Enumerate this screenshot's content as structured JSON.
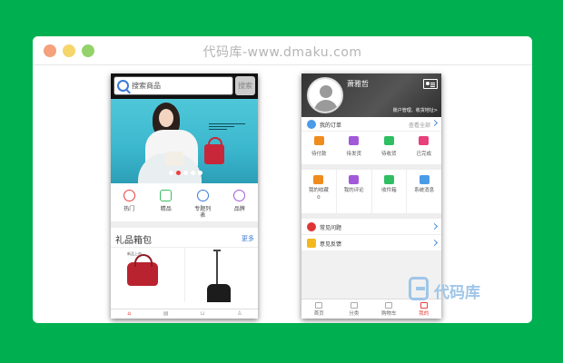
{
  "window": {
    "title": "代码库-www.dmaku.com"
  },
  "shop": {
    "search_placeholder": "搜索商品",
    "search_button": "搜索",
    "categories": [
      "热门",
      "精品",
      "专题列表",
      "品牌"
    ],
    "section_title": "礼品箱包",
    "section_more": "更多",
    "product_label": "新品上市"
  },
  "user": {
    "name": "萧雅哲",
    "account_link": "账户管理、收货地址>",
    "my_orders": "我的订单",
    "view_all": "查看全部",
    "order_states": [
      "待付款",
      "待发货",
      "待收货",
      "已完成"
    ],
    "grid_items": [
      {
        "label": "我的收藏",
        "count": "0"
      },
      {
        "label": "我的评论",
        "count": ""
      },
      {
        "label": "收件箱",
        "count": ""
      },
      {
        "label": "系统消息",
        "count": ""
      }
    ],
    "faq": "常见问题",
    "feedback": "意见反馈",
    "tabs": [
      "首页",
      "分类",
      "购物车",
      "我的"
    ]
  },
  "watermark": {
    "text": "代码库"
  },
  "colors": {
    "background": "#00b050",
    "accent_red": "#e94040",
    "link_blue": "#3a7bd5",
    "order_icons": [
      "#f08c1e",
      "#a259d9",
      "#2fbf62",
      "#e8407a"
    ],
    "grid_icons": [
      "#f08c1e",
      "#a259d9",
      "#2fbf62",
      "#4a9be8"
    ]
  }
}
